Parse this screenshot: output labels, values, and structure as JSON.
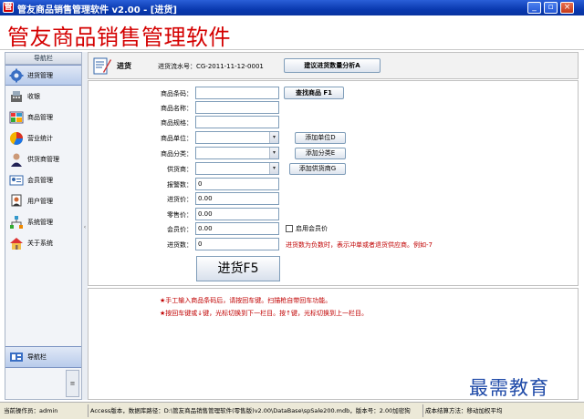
{
  "window": {
    "title": "管友商品销售管理软件 v2.00 - [进货]",
    "minimize": "_",
    "restore": "▫",
    "close": "×"
  },
  "banner": {
    "brand": "管友商品销售管理软件"
  },
  "sidebar": {
    "header": "导航栏",
    "items": [
      {
        "label": "进货管理",
        "icon": "gear-icon",
        "active": true
      },
      {
        "label": "收银",
        "icon": "cash-register-icon"
      },
      {
        "label": "商品管理",
        "icon": "products-icon"
      },
      {
        "label": "营业统计",
        "icon": "pie-chart-icon"
      },
      {
        "label": "供货商管理",
        "icon": "supplier-icon"
      },
      {
        "label": "会员管理",
        "icon": "member-icon"
      },
      {
        "label": "用户管理",
        "icon": "user-icon"
      },
      {
        "label": "系统管理",
        "icon": "network-icon"
      },
      {
        "label": "关于系统",
        "icon": "home-icon"
      }
    ],
    "footer": "导航栏",
    "scroll_glyph": "≡"
  },
  "main": {
    "title": "进货",
    "serial": "进货流水号：CG-2011-11-12-0001",
    "suggest_button": "建议进货数量分析A"
  },
  "form": {
    "barcode_label": "商品条码：",
    "name_label": "商品名称：",
    "spec_label": "商品规格：",
    "unit_label": "商品单位：",
    "category_label": "商品分类：",
    "supplier_label": "供货商：",
    "alert_label": "报警数：",
    "alert_value": "0",
    "purchase_price_label": "进货价：",
    "purchase_price_value": "0.00",
    "retail_price_label": "零售价：",
    "retail_price_value": "0.00",
    "member_price_label": "会员价：",
    "member_price_value": "0.00",
    "quantity_label": "进货数：",
    "quantity_value": "0",
    "find_button": "查找商品 F1",
    "add_unit_button": "添加单位D",
    "add_category_button": "添加分类E",
    "add_supplier_button": "添加供货商G",
    "enable_member_price": "启用会员价",
    "negative_hint": "进货数为负数时，表示冲单或者退货供应商。例如-7",
    "submit_button": "进货F5"
  },
  "tips": [
    "★手工输入商品条码后，请按回车键。扫描枪自带回车功能。",
    "★按回车键或↓键，光标切换到下一栏目。按↑键，光标切换到上一栏目。"
  ],
  "status": {
    "operator": "当前操作员：admin",
    "info": "Access版本，数据库路径：D:\\管友商品销售管理软件(零售版)v2.00\\DataBase\\spSale200.mdb，版本号：2.00加密狗",
    "cost": "成本结算方法：移动加权平均"
  },
  "watermark": "最需教育",
  "colors": {
    "brand_red": "#d40000",
    "hint_red": "#c00000",
    "title_blue": "#0a3ab0"
  }
}
